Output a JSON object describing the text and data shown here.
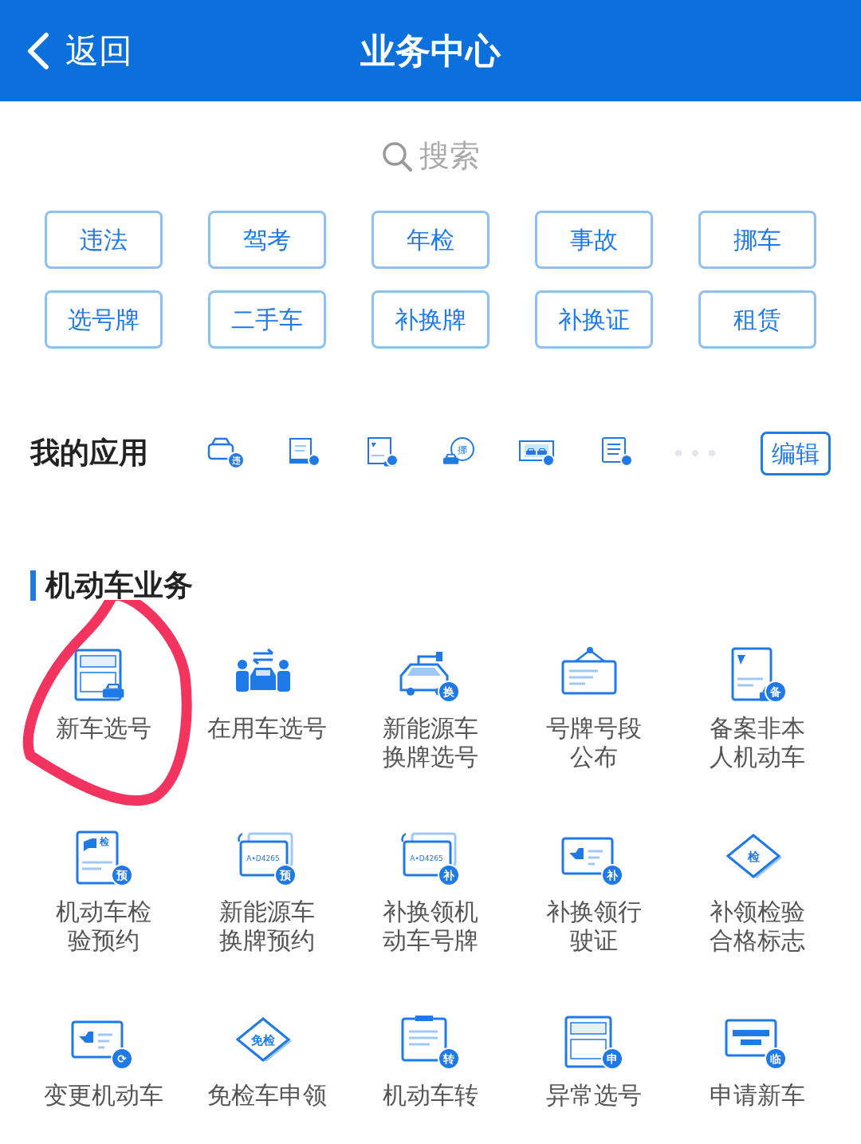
{
  "header": {
    "back": "返回",
    "title": "业务中心"
  },
  "search": {
    "placeholder": "搜索"
  },
  "quick_tags": [
    {
      "label": "违法"
    },
    {
      "label": "驾考"
    },
    {
      "label": "年检"
    },
    {
      "label": "事故"
    },
    {
      "label": "挪车"
    },
    {
      "label": "选号牌"
    },
    {
      "label": "二手车"
    },
    {
      "label": "补换牌"
    },
    {
      "label": "补换证"
    },
    {
      "label": "租赁"
    }
  ],
  "my_apps": {
    "title": "我的应用",
    "edit": "编辑",
    "apps": [
      {
        "kind": "car",
        "badge": "违"
      },
      {
        "kind": "scroll"
      },
      {
        "kind": "file"
      },
      {
        "kind": "bubble",
        "badge": "挪"
      },
      {
        "kind": "photo"
      },
      {
        "kind": "notebook"
      }
    ]
  },
  "section": {
    "title": "机动车业务",
    "services": [
      {
        "kind": "plate-form",
        "lines": [
          "新车选号"
        ]
      },
      {
        "kind": "people",
        "lines": [
          "在用车选号"
        ]
      },
      {
        "kind": "ev",
        "badge": "换",
        "lines": [
          "新能源车",
          "换牌选号"
        ]
      },
      {
        "kind": "board",
        "lines": [
          "号牌号段",
          "公布"
        ]
      },
      {
        "kind": "file",
        "badge": "备",
        "lines": [
          "备案非本",
          "人机动车"
        ]
      },
      {
        "kind": "doc",
        "badge": "预",
        "tag": "检",
        "lines": [
          "机动车检",
          "验预约"
        ]
      },
      {
        "kind": "plate",
        "badge": "预",
        "plate": "A•D4265",
        "lines": [
          "新能源车",
          "换牌预约"
        ]
      },
      {
        "kind": "plate",
        "badge": "补",
        "plate": "A•D4265",
        "lines": [
          "补换领机",
          "动车号牌"
        ]
      },
      {
        "kind": "card",
        "badge": "补",
        "lines": [
          "补换领行",
          "驶证"
        ]
      },
      {
        "kind": "diamond",
        "tag": "检",
        "lines": [
          "补领检验",
          "合格标志"
        ]
      },
      {
        "kind": "card",
        "badge": "⟳",
        "lines": [
          "变更机动车"
        ]
      },
      {
        "kind": "diamond",
        "tag": "免检",
        "lines": [
          "免检车申领"
        ]
      },
      {
        "kind": "clipboard",
        "badge": "转",
        "lines": [
          "机动车转"
        ]
      },
      {
        "kind": "plate-form",
        "badge": "申",
        "lines": [
          "异常选号"
        ]
      },
      {
        "kind": "plate-blank",
        "badge": "临",
        "lines": [
          "申请新车"
        ]
      }
    ]
  }
}
